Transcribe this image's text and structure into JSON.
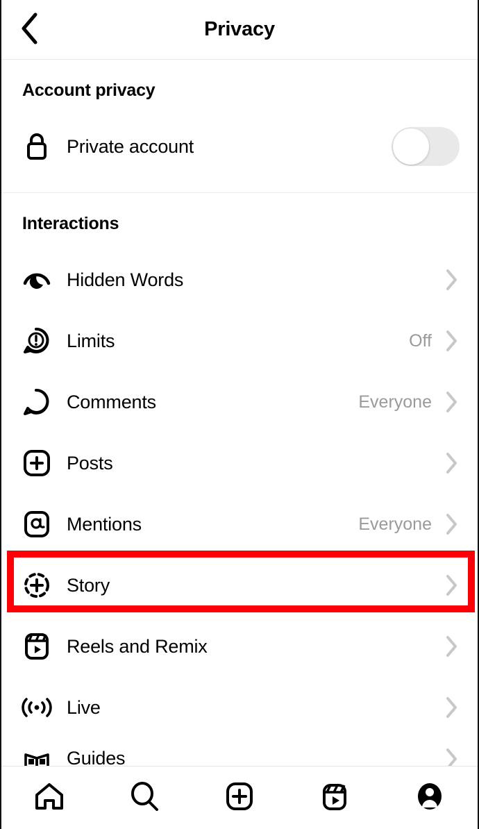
{
  "header": {
    "title": "Privacy",
    "back_icon": "chevron-left-icon"
  },
  "sections": [
    {
      "title": "Account privacy",
      "rows": [
        {
          "label": "Private account",
          "icon": "lock-icon",
          "control": "toggle",
          "toggle_on": false,
          "value": ""
        }
      ]
    },
    {
      "title": "Interactions",
      "rows": [
        {
          "label": "Hidden Words",
          "icon": "hidden-words-icon",
          "value": "",
          "control": "chevron"
        },
        {
          "label": "Limits",
          "icon": "limits-icon",
          "value": "Off",
          "control": "chevron"
        },
        {
          "label": "Comments",
          "icon": "comment-bubble-icon",
          "value": "Everyone",
          "control": "chevron"
        },
        {
          "label": "Posts",
          "icon": "posts-plus-icon",
          "value": "",
          "control": "chevron"
        },
        {
          "label": "Mentions",
          "icon": "mention-at-icon",
          "value": "Everyone",
          "control": "chevron"
        },
        {
          "label": "Story",
          "icon": "story-plus-icon",
          "value": "",
          "control": "chevron",
          "highlighted": true
        },
        {
          "label": "Reels and Remix",
          "icon": "reels-icon",
          "value": "",
          "control": "chevron"
        },
        {
          "label": "Live",
          "icon": "live-broadcast-icon",
          "value": "",
          "control": "chevron"
        },
        {
          "label": "Guides",
          "icon": "guides-book-icon",
          "value": "",
          "control": "chevron"
        }
      ]
    }
  ],
  "bottom_nav": [
    {
      "name": "home",
      "icon": "home-icon"
    },
    {
      "name": "search",
      "icon": "search-icon"
    },
    {
      "name": "create",
      "icon": "create-plus-icon"
    },
    {
      "name": "reels",
      "icon": "reels-icon"
    },
    {
      "name": "profile",
      "icon": "profile-avatar-icon"
    }
  ],
  "colors": {
    "accent_highlight": "#fb0007",
    "text_primary": "#000000",
    "text_secondary": "#9a9a9a",
    "chevron": "#c8c8c8",
    "toggle_track_off": "#e9e9e9",
    "divider": "#ededed"
  }
}
